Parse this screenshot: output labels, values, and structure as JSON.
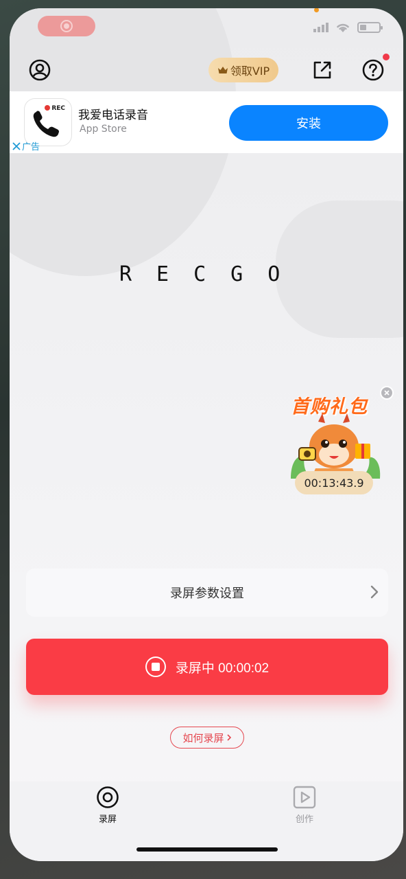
{
  "status_bar": {
    "signal_icon": "signal-icon",
    "wifi_icon": "wifi-icon",
    "battery_icon": "battery-icon",
    "battery_level": 0.3,
    "recording_indicator": "record-indicator-icon"
  },
  "header": {
    "profile_icon": "user-circle-icon",
    "vip_label": "领取VIP",
    "vip_icon": "crown-icon",
    "share_icon": "share-icon",
    "help_icon": "help-icon"
  },
  "ad": {
    "app_name": "我爱电话录音",
    "store": "App Store",
    "install_label": "安装",
    "ad_label": "广告",
    "icon_badge": "REC"
  },
  "logo_text": "RECGO",
  "promo": {
    "title": "首购礼包",
    "timer": "00:13:43.9"
  },
  "settings": {
    "label": "录屏参数设置"
  },
  "record": {
    "label": "录屏中 00:00:02"
  },
  "howto": {
    "label": "如何录屏"
  },
  "tabs": [
    {
      "label": "录屏",
      "icon": "record-tab-icon",
      "active": true
    },
    {
      "label": "创作",
      "icon": "play-tab-icon",
      "active": false
    }
  ],
  "colors": {
    "record_red": "#fa3c45",
    "install_blue": "#0a84ff",
    "vip_gold": "#f0c98c",
    "promo_orange": "#ff6a1a"
  }
}
